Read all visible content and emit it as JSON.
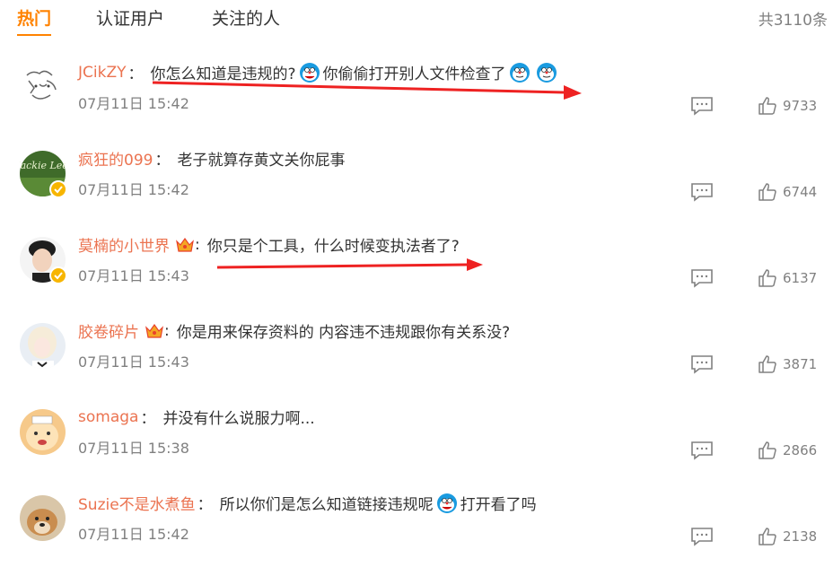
{
  "tabs": [
    {
      "label": "热门"
    },
    {
      "label": "认证用户"
    },
    {
      "label": "关注的人"
    }
  ],
  "total_count": "共3110条",
  "accent_color": "#ff8200",
  "username_color": "#eb7350",
  "comments": [
    {
      "user": "JCikZY",
      "text_parts": [
        "你怎么知道是违规的?",
        "你偷偷打开别人文件检查了"
      ],
      "emojis": [
        "doraemon-emoji",
        "doraemon-emoji",
        "doraemon-emoji"
      ],
      "time": "07月11日 15:42",
      "likes": "9733"
    },
    {
      "user": "疯狂的099",
      "text_parts": [
        "老子就算存黄文关你屁事"
      ],
      "verified": true,
      "avatar_text": "Jackie Lee",
      "time": "07月11日 15:42",
      "likes": "6744"
    },
    {
      "user": "莫楠的小世界",
      "text_parts": [
        "你只是个工具，什么时候变执法者了?"
      ],
      "verified": true,
      "crown": true,
      "time": "07月11日 15:43",
      "likes": "6137"
    },
    {
      "user": "胶卷碎片",
      "text_parts": [
        "你是用来保存资料的 内容违不违规跟你有关系没?"
      ],
      "crown": true,
      "time": "07月11日 15:43",
      "likes": "3871"
    },
    {
      "user": "somaga",
      "text_parts": [
        "并没有什么说服力啊..."
      ],
      "time": "07月11日 15:38",
      "likes": "2866"
    },
    {
      "user": "Suzie不是水煮鱼",
      "text_parts": [
        "所以你们是怎么知道链接违规呢",
        "打开看了吗"
      ],
      "emojis": [
        "doraemon-emoji"
      ],
      "time": "07月11日 15:42",
      "likes": "2138"
    }
  ]
}
